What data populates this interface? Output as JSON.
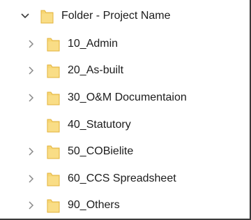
{
  "tree": {
    "root": {
      "label": "Folder - Project Name",
      "icon": "folder-icon",
      "expanded": true
    },
    "children": [
      {
        "label": "10_Admin",
        "has_children": true
      },
      {
        "label": "20_As-built",
        "has_children": true
      },
      {
        "label": "30_O&M Documentaion",
        "has_children": true
      },
      {
        "label": "40_Statutory",
        "has_children": false
      },
      {
        "label": "50_COBielite",
        "has_children": true
      },
      {
        "label": "60_CCS Spreadsheet",
        "has_children": true
      },
      {
        "label": "90_Others",
        "has_children": true
      }
    ]
  },
  "colors": {
    "folder_fill": "#F7D674",
    "folder_edge": "#E2B23A",
    "chevron": "#8a8a8a",
    "chevron_expanded": "#3a3a3a",
    "frame_border": "#3a3a3a"
  }
}
